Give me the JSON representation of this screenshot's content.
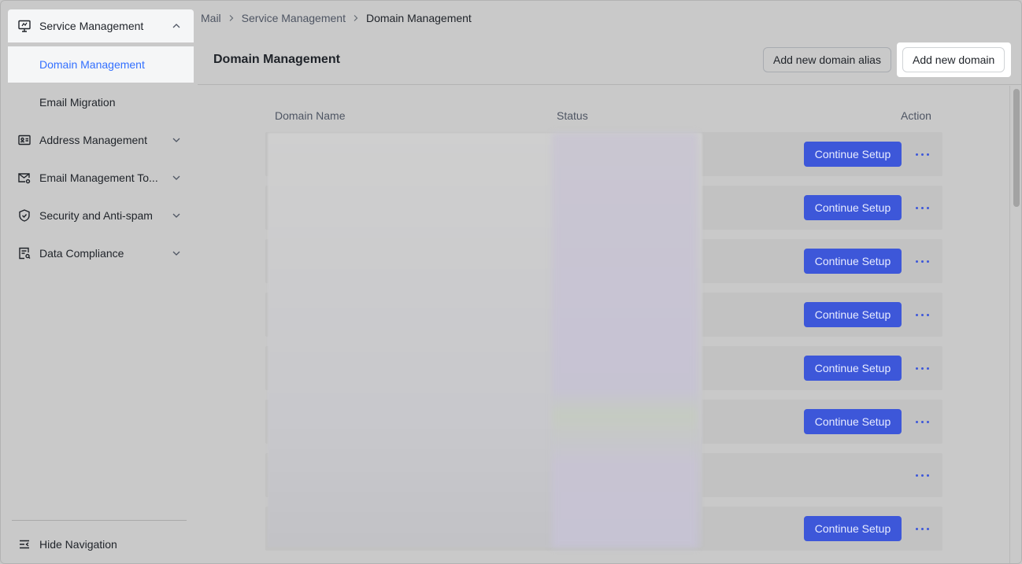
{
  "sidebar": {
    "items": [
      {
        "label": "Service Management",
        "icon": "monitor-icon"
      },
      {
        "label": "Domain Management"
      },
      {
        "label": "Email Migration"
      },
      {
        "label": "Address Management",
        "icon": "id-card-icon"
      },
      {
        "label": "Email Management To...",
        "icon": "mail-settings-icon"
      },
      {
        "label": "Security and Anti-spam",
        "icon": "shield-icon"
      },
      {
        "label": "Data Compliance",
        "icon": "document-search-icon"
      }
    ],
    "hide_label": "Hide Navigation"
  },
  "breadcrumb": [
    "Mail",
    "Service Management",
    "Domain Management"
  ],
  "header": {
    "title": "Domain Management",
    "alias_button": "Add new domain alias",
    "add_button": "Add new domain"
  },
  "table": {
    "columns": [
      "Domain Name",
      "Status",
      "Action"
    ],
    "rows": [
      {
        "action": "Continue Setup"
      },
      {
        "action": "Continue Setup"
      },
      {
        "action": "Continue Setup"
      },
      {
        "action": "Continue Setup"
      },
      {
        "action": "Continue Setup"
      },
      {
        "action": "Continue Setup"
      },
      {
        "action": ""
      },
      {
        "action": "Continue Setup"
      }
    ]
  },
  "colors": {
    "accent": "#3370ff",
    "primary_button": "#3d57d9"
  }
}
